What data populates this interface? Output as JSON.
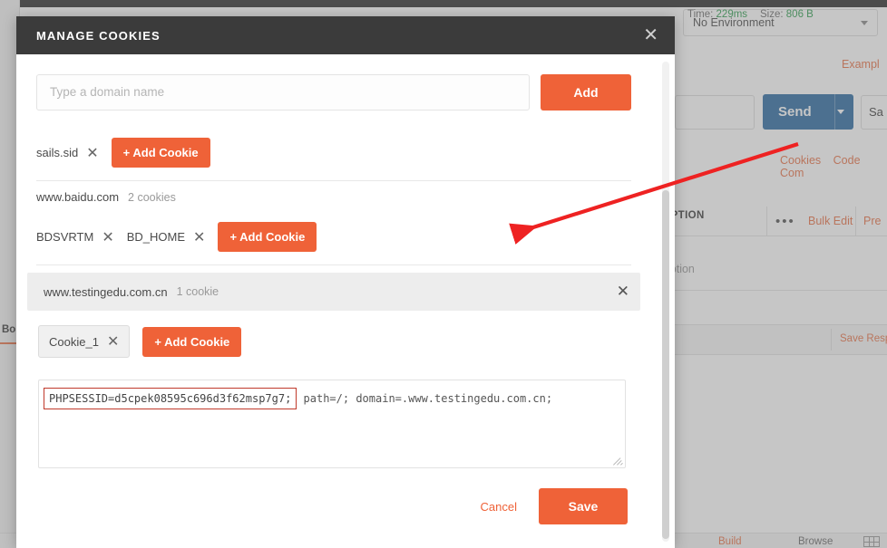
{
  "modal": {
    "title": "MANAGE COOKIES",
    "close_icon": "close-icon",
    "domain_input": {
      "placeholder": "Type a domain name",
      "value": ""
    },
    "add_label": "Add",
    "groups": [
      {
        "domain": "",
        "count": "",
        "cookies": [
          {
            "name": "sails.sid"
          }
        ],
        "add_cookie_label": "+ Add Cookie"
      },
      {
        "domain": "www.baidu.com",
        "count": "2 cookies",
        "cookies": [
          {
            "name": "BDSVRTM"
          },
          {
            "name": "BD_HOME"
          }
        ],
        "add_cookie_label": "+ Add Cookie"
      },
      {
        "domain": "www.testingedu.com.cn",
        "count": "1 cookie",
        "cookies": [
          {
            "name": "Cookie_1"
          }
        ],
        "add_cookie_label": "+ Add Cookie"
      }
    ],
    "editor": {
      "highlighted": "PHPSESSID=d5cpek08595c696d3f62msp7g7;",
      "rest": " path=/; domain=.www.testingedu.com.cn;"
    },
    "footer": {
      "cancel_label": "Cancel",
      "save_label": "Save"
    }
  },
  "background": {
    "environment_select": "No Environment",
    "examples_label": "Exampl",
    "send_label": "Send",
    "save_label": "Sa",
    "links": [
      "Cookies",
      "Code",
      "Com"
    ],
    "description_header": "IPTION",
    "bulk_edit_label": "Bulk Edit",
    "presets_label": "Pre",
    "description_placeholder": "iption",
    "status": {
      "close_icon": "close-icon",
      "time_key": "Time:",
      "time_value": "229ms",
      "size_key": "Size:",
      "size_value": "806 B",
      "save_response_label": "Save Resp"
    },
    "body_tab_label": "Bo",
    "build_label": "Build",
    "browse_label": "Browse"
  },
  "colors": {
    "accent_orange": "#ef6238",
    "header_dark": "#3b3b3b",
    "send_blue": "#2d6ca2",
    "annotation_red": "#ee2222",
    "status_green": "#2e9e4f"
  }
}
